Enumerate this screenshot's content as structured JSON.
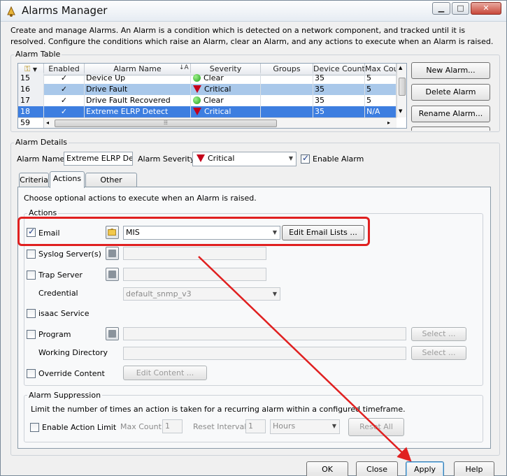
{
  "window": {
    "title": "Alarms Manager"
  },
  "description": "Create and manage Alarms. An Alarm is a condition which is detected on a network component, and tracked until it is resolved. Configure the conditions which raise an Alarm, clear an Alarm, and any actions to execute when an Alarm is raised.",
  "alarm_table": {
    "group_title": "Alarm Table",
    "columns": [
      "Enabled",
      "Alarm Name",
      "Severity",
      "Groups",
      "Device Count",
      "Max Cou"
    ],
    "rows": [
      {
        "num": "15",
        "enabled": "✓",
        "name": "Device Up",
        "severity": "Clear",
        "groups": "",
        "device_count": "35",
        "max_count": "5"
      },
      {
        "num": "16",
        "enabled": "✓",
        "name": "Drive Fault",
        "severity": "Critical",
        "groups": "",
        "device_count": "35",
        "max_count": "5"
      },
      {
        "num": "17",
        "enabled": "✓",
        "name": "Drive Fault Recovered",
        "severity": "Clear",
        "groups": "",
        "device_count": "35",
        "max_count": "5"
      },
      {
        "num": "18",
        "enabled": "✓",
        "name": "Extreme ELRP Detect",
        "severity": "Critical",
        "groups": "",
        "device_count": "35",
        "max_count": "N/A"
      }
    ],
    "row_count": "59",
    "buttons": {
      "new": "New Alarm...",
      "delete": "Delete Alarm",
      "rename": "Rename Alarm..."
    }
  },
  "alarm_details": {
    "group_title": "Alarm Details",
    "name_label": "Alarm Name:",
    "name_value": "Extreme ELRP Detec",
    "severity_label": "Alarm Severity:",
    "severity_value": "Critical",
    "enable_label": "Enable Alarm"
  },
  "tabs": [
    "Criteria",
    "Actions",
    "Other Options"
  ],
  "actions_tab": {
    "intro": "Choose optional actions to execute when an Alarm is raised.",
    "group_title": "Actions",
    "email_label": "Email",
    "email_value": "MIS",
    "edit_email_button": "Edit Email Lists ...",
    "syslog_label": "Syslog Server(s)",
    "trap_label": "Trap Server",
    "credential_label": "Credential",
    "credential_value": "default_snmp_v3",
    "isaac_label": "isaac Service",
    "program_label": "Program",
    "workdir_label": "Working Directory",
    "select_button": "Select ...",
    "override_label": "Override Content",
    "edit_content_button": "Edit Content ..."
  },
  "suppression": {
    "group_title": "Alarm Suppression",
    "text": "Limit the number of times an action is taken for a recurring alarm within a configured timeframe.",
    "enable_label": "Enable Action Limit",
    "max_count_label": "Max Count:",
    "max_count_value": "1",
    "reset_label": "Reset Interval:",
    "reset_value": "1",
    "unit_value": "Hours",
    "reset_all_button": "Reset All"
  },
  "footer": {
    "ok": "OK",
    "close": "Close",
    "apply": "Apply",
    "help": "Help"
  },
  "colors": {
    "annotation": "#e02020",
    "selection": "#3d7ee0",
    "critical": "#c4001a",
    "clear": "#1f9e1a"
  }
}
